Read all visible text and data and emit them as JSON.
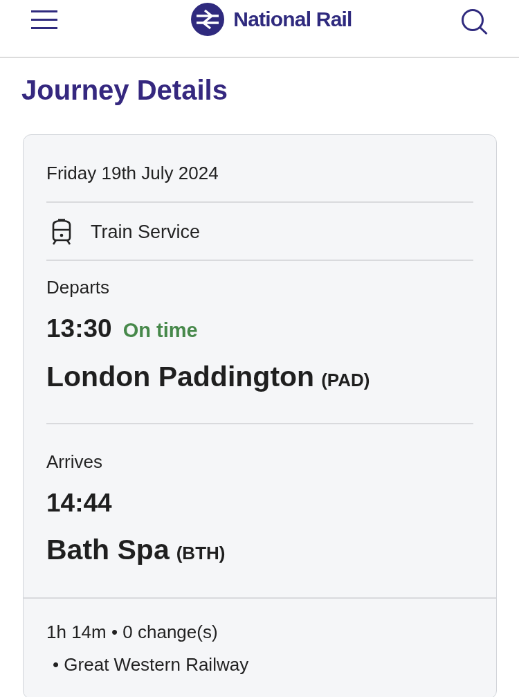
{
  "header": {
    "brand": "National Rail"
  },
  "page_title": "Journey Details",
  "journey": {
    "date": "Friday 19th July 2024",
    "service_type": "Train Service",
    "legs": [
      {
        "label": "Departs",
        "time": "13:30",
        "status": {
          "kind": "on_time",
          "text": "On time"
        },
        "station": "London Paddington",
        "code": "(PAD)"
      },
      {
        "label": "Arrives",
        "time": "14:44",
        "station": "Bath Spa",
        "code": "(BTH)"
      }
    ],
    "summary": "1h 14m • 0 change(s)",
    "operators": [
      "• Great Western Railway"
    ]
  }
}
